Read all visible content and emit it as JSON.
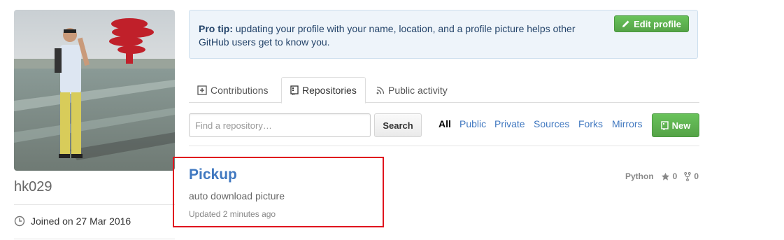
{
  "profile": {
    "username": "hk029",
    "joined": "Joined on 27 Mar 2016"
  },
  "protip": {
    "label": "Pro tip:",
    "text": " updating your profile with your name, location, and a profile picture helps other GitHub users get to know you.",
    "edit_button": "Edit profile"
  },
  "tabs": [
    {
      "label": "Contributions",
      "icon": "plus-square-icon"
    },
    {
      "label": "Repositories",
      "icon": "repo-icon",
      "selected": true
    },
    {
      "label": "Public activity",
      "icon": "rss-icon"
    }
  ],
  "repo_filter": {
    "search_placeholder": "Find a repository…",
    "search_button": "Search",
    "filters": [
      "All",
      "Public",
      "Private",
      "Sources",
      "Forks",
      "Mirrors"
    ],
    "active_filter": "All",
    "new_button": "New"
  },
  "repos": [
    {
      "name": "Pickup",
      "description": "auto download picture",
      "updated": "Updated 2 minutes ago",
      "language": "Python",
      "stars": "0",
      "forks": "0"
    }
  ],
  "colors": {
    "link": "#4078c0",
    "green": "#55a347",
    "highlight": "#e0141e"
  }
}
